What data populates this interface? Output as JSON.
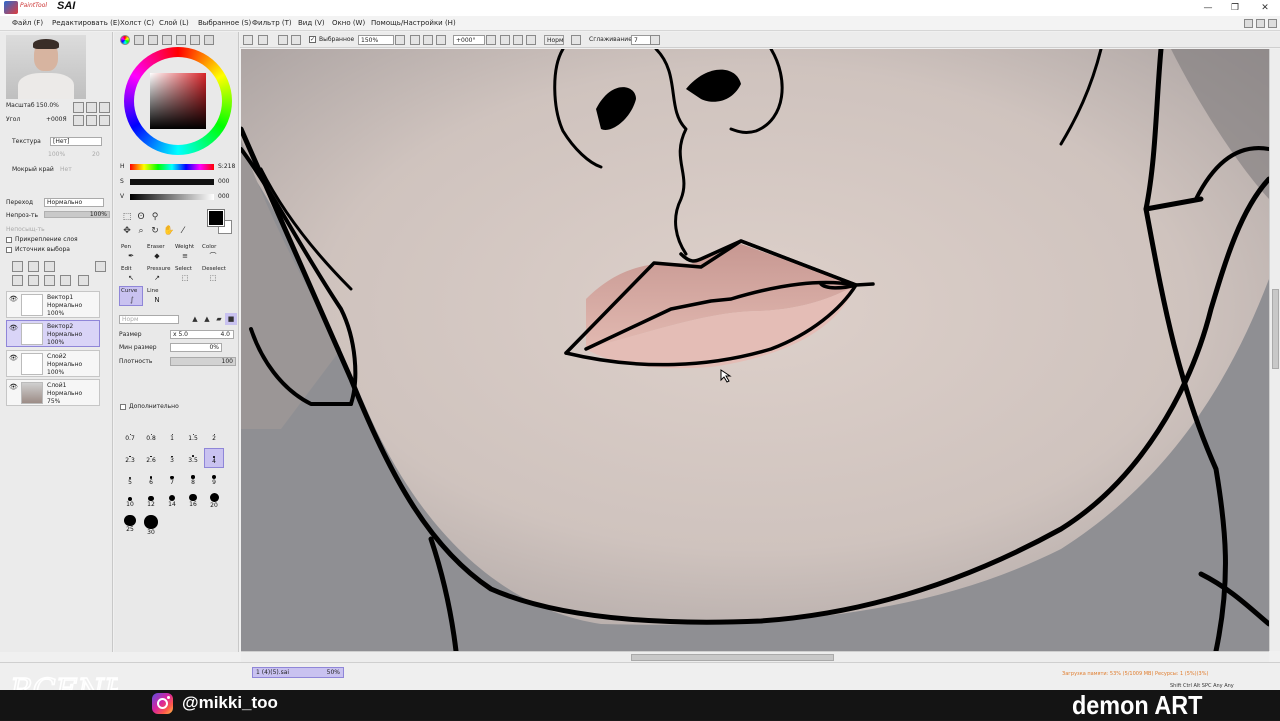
{
  "app": {
    "title_prefix": "PaintTool",
    "title_name": "SAI"
  },
  "window_controls": [
    "—",
    "❐",
    "✕"
  ],
  "menu": [
    "Файл (F)",
    "Редактировать (E)",
    "Холст (C)",
    "Слой (L)",
    "Выбранное (S)",
    "Фильтр (T)",
    "Вид (V)",
    "Окно (W)",
    "Помощь/Настройки (H)"
  ],
  "toolbar": {
    "selected_label": "Выбранное",
    "zoom_value": "150%",
    "angle_value": "+000°",
    "norm_label": "Норм",
    "stabilizer_label": "Сглаживание",
    "stabilizer_value": "7"
  },
  "navigator": {
    "zoom_label": "Масштаб",
    "zoom_value": "150.0%",
    "angle_label": "Угол",
    "angle_value": "+000Я"
  },
  "left_props": {
    "texture_label": "Текстура",
    "texture_value": "[Нет]",
    "texture_amount": "100%",
    "texture_num": "20",
    "wet_edge_label": "Мокрый край",
    "wet_edge_value": "Нет",
    "blend_label": "Переход",
    "blend_value": "Нормально",
    "opacity_label": "Непроз-ть",
    "opacity_value": "100%",
    "opacity_fraction": 1.0,
    "protect_label": "Непосыщ-ть",
    "clip_label": "Прикрепление слоя",
    "source_label": "Источник выбора"
  },
  "layers": [
    {
      "name": "Вектор1",
      "mode": "Нормально",
      "opacity": "100%",
      "selected": false
    },
    {
      "name": "Вектор2",
      "mode": "Нормально",
      "opacity": "100%",
      "selected": true
    },
    {
      "name": "Слой2",
      "mode": "Нормально",
      "opacity": "100%",
      "selected": false
    },
    {
      "name": "Слой1",
      "mode": "Нормально",
      "opacity": "75%",
      "selected": false
    }
  ],
  "color": {
    "h_label": "H",
    "h_value": "S:218",
    "s_label": "S",
    "s_value": "000",
    "v_label": "V",
    "v_value": "000",
    "foreground": "#000000",
    "background": "#ffffff"
  },
  "tools": {
    "tabs": [
      "Pen",
      "Eraser",
      "Weight",
      "Color",
      "Edit",
      "Pressure",
      "Select",
      "Deselect",
      "Curve",
      "Line"
    ],
    "selected": "Curve"
  },
  "brush_props": {
    "mode_label": "Норм",
    "size_label": "Размер",
    "size_multiplier": "x 5.0",
    "size_value": "4.0",
    "min_size_label": "Мин размер",
    "min_size_value": "0%",
    "density_label": "Плотность",
    "density_value": "100",
    "advanced_label": "Дополнительно",
    "sizes": [
      "0.7",
      "0.8",
      "1",
      "1.5",
      "2",
      "2.3",
      "2.6",
      "3",
      "3.5",
      "4",
      "5",
      "6",
      "7",
      "8",
      "9",
      "10",
      "12",
      "14",
      "16",
      "20",
      "25",
      "30"
    ],
    "selected_size": "4"
  },
  "status": {
    "file_name": "1 (4)(5).sai",
    "file_zoom": "50%",
    "sysinfo": "Загрузка памяти: 53% (5/1009 MB)  Ресурсы: 1 (5%)(3%)",
    "keys": "Shift Ctrl Alt SPC Any Any"
  },
  "overlay": {
    "instagram_handle": "@mikki_too",
    "brand": "demon ART",
    "signature_text": "RCENP"
  },
  "colors": {
    "selection_accent": "#c9c2f0",
    "skin": "#d8c6bd",
    "lips": "#d9a9a3",
    "ink": "#000000"
  }
}
